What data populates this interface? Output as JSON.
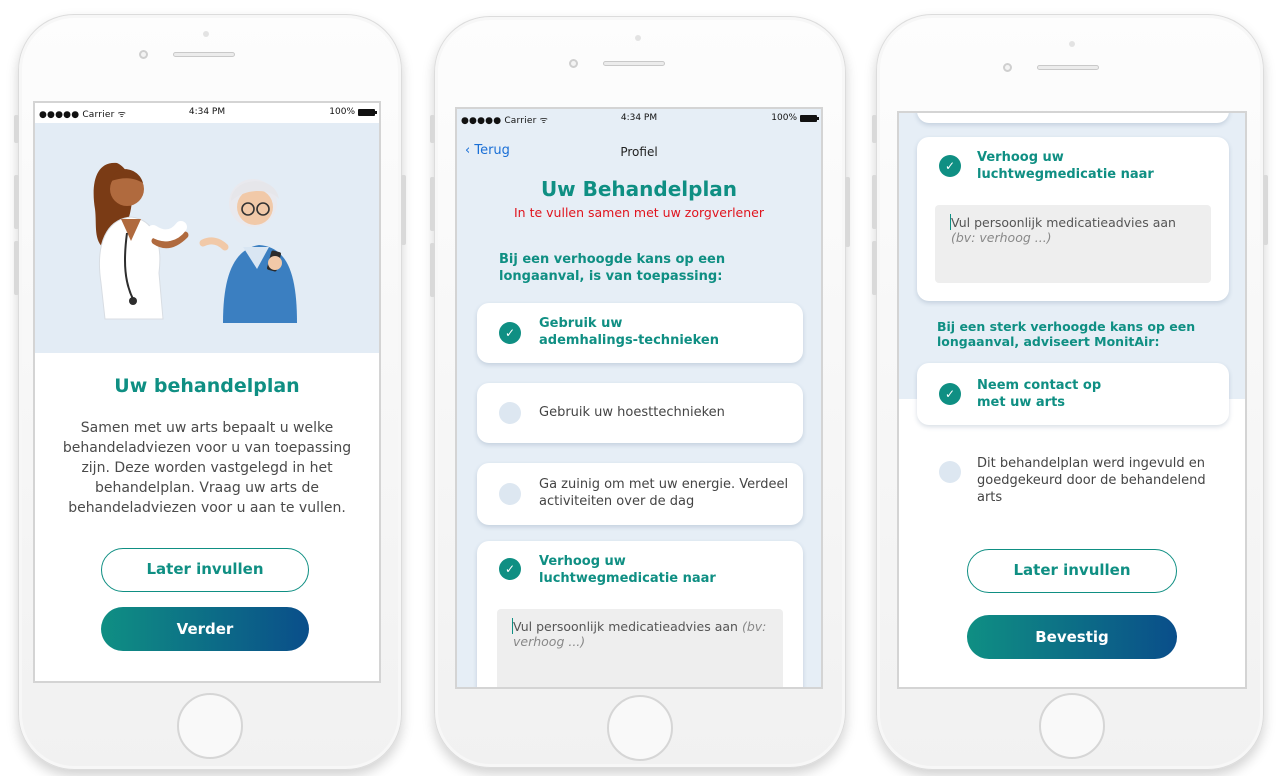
{
  "status_bar": {
    "carrier": "●●●●● Carrier ᯤ",
    "time": "4:34 PM",
    "battery": "100%"
  },
  "screen1": {
    "title": "Uw behandelplan",
    "body": "Samen met uw arts bepaalt u welke behandeladviezen voor u van toepassing zijn. Deze worden vastgelegd in het behandelplan. Vraag uw arts de behandeladviezen voor u aan te vullen.",
    "later_button": "Later invullen",
    "next_button": "Verder"
  },
  "screen2": {
    "back_label": "Terug",
    "nav_title": "Profiel",
    "title": "Uw Behandelplan",
    "subtitle": "In te vullen samen met uw zorgverlener",
    "section_heading": "Bij een verhoogde kans op een longaanval, is van toepassing:",
    "items": [
      {
        "label": "Gebruik uw ademhalings-technieken",
        "checked": true
      },
      {
        "label": "Gebruik uw hoesttechnieken",
        "checked": false
      },
      {
        "label": "Ga zuinig om met uw energie. Verdeel activiteiten over de dag",
        "checked": false
      },
      {
        "label": "Verhoog uw luchtwegmedicatie naar",
        "checked": true
      }
    ],
    "advice_placeholder": "Vul persoonlijk medicatieadvies aan",
    "advice_example": "(bv: verhoog ...)"
  },
  "screen3": {
    "medication_label": "Verhoog uw luchtwegmedicatie naar",
    "medication_checked": true,
    "advice_placeholder": "Vul persoonlijk medicatieadvies aan",
    "advice_example": "(bv: verhoog ...)",
    "section_heading": "Bij een sterk verhoogde kans op een longaanval, adviseert MonitAir:",
    "contact_label": "Neem contact op met uw arts",
    "contact_checked": true,
    "approval_label": "Dit behandelplan werd ingevuld en goedgekeurd door de behandelend arts",
    "approval_checked": false,
    "later_button": "Later invullen",
    "confirm_button": "Bevestig"
  },
  "colors": {
    "accent": "#0f8f83",
    "accent_dark": "#0a4e8a",
    "warning": "#e0141e",
    "panel_bg": "#e6eef6"
  },
  "icons": [
    "back-chevron-icon",
    "check-icon",
    "wifi-icon",
    "battery-icon"
  ]
}
